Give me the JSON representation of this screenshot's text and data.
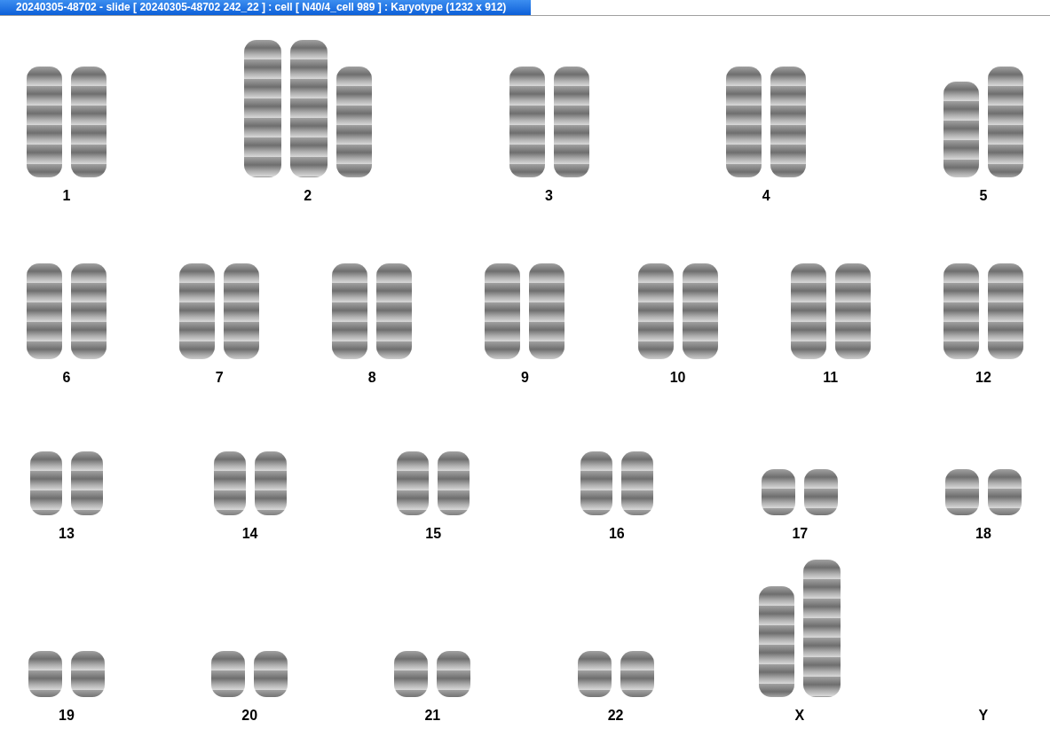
{
  "window": {
    "title": "20240305-48702 - slide [ 20240305-48702 242_22 ] : cell [ N40/4_cell 989 ] : Karyotype  (1232 x 912)"
  },
  "karyotype": {
    "rows": [
      {
        "groups": [
          {
            "label": "1",
            "chromosomes": [
              {
                "kind": "long"
              },
              {
                "kind": "long"
              }
            ]
          },
          {
            "label": "2",
            "chromosomes": [
              {
                "kind": "xlong"
              },
              {
                "kind": "xlong"
              },
              {
                "kind": "long"
              }
            ]
          },
          {
            "label": "3",
            "chromosomes": [
              {
                "kind": "long"
              },
              {
                "kind": "long"
              }
            ]
          },
          {
            "label": "4",
            "chromosomes": [
              {
                "kind": "long"
              },
              {
                "kind": "long"
              }
            ]
          },
          {
            "label": "5",
            "chromosomes": [
              {
                "kind": "medium"
              },
              {
                "kind": "long"
              }
            ]
          }
        ]
      },
      {
        "groups": [
          {
            "label": "6",
            "chromosomes": [
              {
                "kind": "medium"
              },
              {
                "kind": "medium"
              }
            ]
          },
          {
            "label": "7",
            "chromosomes": [
              {
                "kind": "medium"
              },
              {
                "kind": "medium"
              }
            ]
          },
          {
            "label": "8",
            "chromosomes": [
              {
                "kind": "medium"
              },
              {
                "kind": "medium"
              }
            ]
          },
          {
            "label": "9",
            "chromosomes": [
              {
                "kind": "medium"
              },
              {
                "kind": "medium"
              }
            ]
          },
          {
            "label": "10",
            "chromosomes": [
              {
                "kind": "medium"
              },
              {
                "kind": "medium"
              }
            ]
          },
          {
            "label": "11",
            "chromosomes": [
              {
                "kind": "medium"
              },
              {
                "kind": "medium"
              }
            ]
          },
          {
            "label": "12",
            "chromosomes": [
              {
                "kind": "medium"
              },
              {
                "kind": "medium"
              }
            ]
          }
        ]
      },
      {
        "groups": [
          {
            "label": "13",
            "chromosomes": [
              {
                "kind": "short"
              },
              {
                "kind": "short"
              }
            ]
          },
          {
            "label": "14",
            "chromosomes": [
              {
                "kind": "short"
              },
              {
                "kind": "short"
              }
            ]
          },
          {
            "label": "15",
            "chromosomes": [
              {
                "kind": "short"
              },
              {
                "kind": "short"
              }
            ]
          },
          {
            "label": "16",
            "chromosomes": [
              {
                "kind": "short"
              },
              {
                "kind": "short"
              }
            ]
          },
          {
            "label": "17",
            "chromosomes": [
              {
                "kind": "tiny"
              },
              {
                "kind": "tiny"
              }
            ]
          },
          {
            "label": "18",
            "chromosomes": [
              {
                "kind": "tiny"
              },
              {
                "kind": "tiny"
              }
            ]
          }
        ]
      },
      {
        "groups": [
          {
            "label": "19",
            "chromosomes": [
              {
                "kind": "tiny"
              },
              {
                "kind": "tiny"
              }
            ]
          },
          {
            "label": "20",
            "chromosomes": [
              {
                "kind": "tiny"
              },
              {
                "kind": "tiny"
              }
            ]
          },
          {
            "label": "21",
            "chromosomes": [
              {
                "kind": "tiny"
              },
              {
                "kind": "tiny"
              }
            ]
          },
          {
            "label": "22",
            "chromosomes": [
              {
                "kind": "tiny"
              },
              {
                "kind": "tiny"
              }
            ]
          },
          {
            "label": "X",
            "chromosomes": [
              {
                "kind": "long"
              },
              {
                "kind": "xlong"
              }
            ]
          },
          {
            "label": "Y"
          }
        ]
      }
    ]
  }
}
